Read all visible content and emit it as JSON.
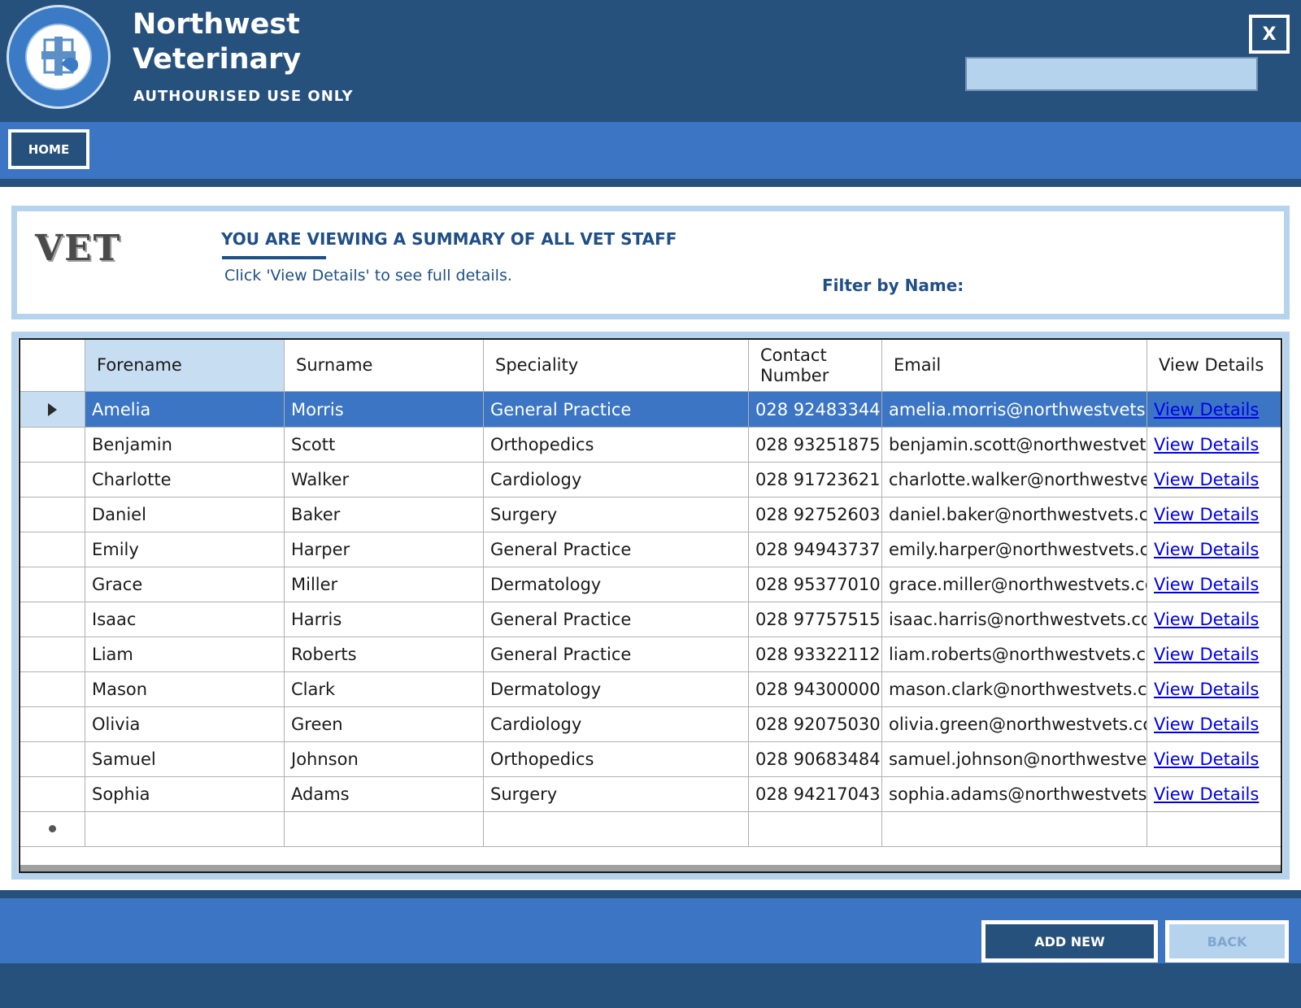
{
  "header": {
    "brand_line1": "Northwest",
    "brand_line2": "Veterinary",
    "subtitle": "AUTHOURISED USE ONLY",
    "close_label": "X"
  },
  "nav": {
    "home_label": "HOME"
  },
  "panel": {
    "logo_text": "VET",
    "title": "YOU ARE VIEWING A SUMMARY OF ALL VET STAFF",
    "subtitle": "Click 'View Details' to see full details.",
    "filter_label": "Filter by Name:",
    "filter_value": ""
  },
  "grid": {
    "columns": [
      "Forename",
      "Surname",
      "Speciality",
      "Contact Number",
      "Email",
      "View Details"
    ],
    "rows": [
      {
        "forename": "Amelia",
        "surname": "Morris",
        "speciality": "General Practice",
        "contact": "028 92483344",
        "email": "amelia.morris@northwestvets.c...",
        "link": "View Details"
      },
      {
        "forename": "Benjamin",
        "surname": "Scott",
        "speciality": "Orthopedics",
        "contact": "028 93251875",
        "email": "benjamin.scott@northwestvets...",
        "link": "View Details"
      },
      {
        "forename": "Charlotte",
        "surname": "Walker",
        "speciality": "Cardiology",
        "contact": "028 91723621",
        "email": "charlotte.walker@northwestve...",
        "link": "View Details"
      },
      {
        "forename": "Daniel",
        "surname": "Baker",
        "speciality": "Surgery",
        "contact": "028 92752603",
        "email": "daniel.baker@northwestvets.c...",
        "link": "View Details"
      },
      {
        "forename": "Emily",
        "surname": "Harper",
        "speciality": "General Practice",
        "contact": "028 94943737",
        "email": "emily.harper@northwestvets.c...",
        "link": "View Details"
      },
      {
        "forename": "Grace",
        "surname": "Miller",
        "speciality": "Dermatology",
        "contact": "028 95377010",
        "email": "grace.miller@northwestvets.co...",
        "link": "View Details"
      },
      {
        "forename": "Isaac",
        "surname": "Harris",
        "speciality": "General Practice",
        "contact": "028 97757515",
        "email": "isaac.harris@northwestvets.co...",
        "link": "View Details"
      },
      {
        "forename": "Liam",
        "surname": "Roberts",
        "speciality": "General Practice",
        "contact": "028 93322112",
        "email": "liam.roberts@northwestvets.co...",
        "link": "View Details"
      },
      {
        "forename": "Mason",
        "surname": "Clark",
        "speciality": "Dermatology",
        "contact": "028 94300000",
        "email": "mason.clark@northwestvets.c...",
        "link": "View Details"
      },
      {
        "forename": "Olivia",
        "surname": "Green",
        "speciality": "Cardiology",
        "contact": "028 92075030",
        "email": "olivia.green@northwestvets.co...",
        "link": "View Details"
      },
      {
        "forename": "Samuel",
        "surname": "Johnson",
        "speciality": "Orthopedics",
        "contact": "028 90683484",
        "email": "samuel.johnson@northwestvet...",
        "link": "View Details"
      },
      {
        "forename": "Sophia",
        "surname": "Adams",
        "speciality": "Surgery",
        "contact": "028 94217043",
        "email": "sophia.adams@northwestvets....",
        "link": "View Details"
      }
    ]
  },
  "footer": {
    "add_label": "ADD NEW",
    "back_label": "BACK"
  },
  "colors": {
    "dark_blue": "#26517d",
    "mid_blue": "#3b75c3",
    "light_blue": "#b5d3ec",
    "link": "#0000ee"
  }
}
